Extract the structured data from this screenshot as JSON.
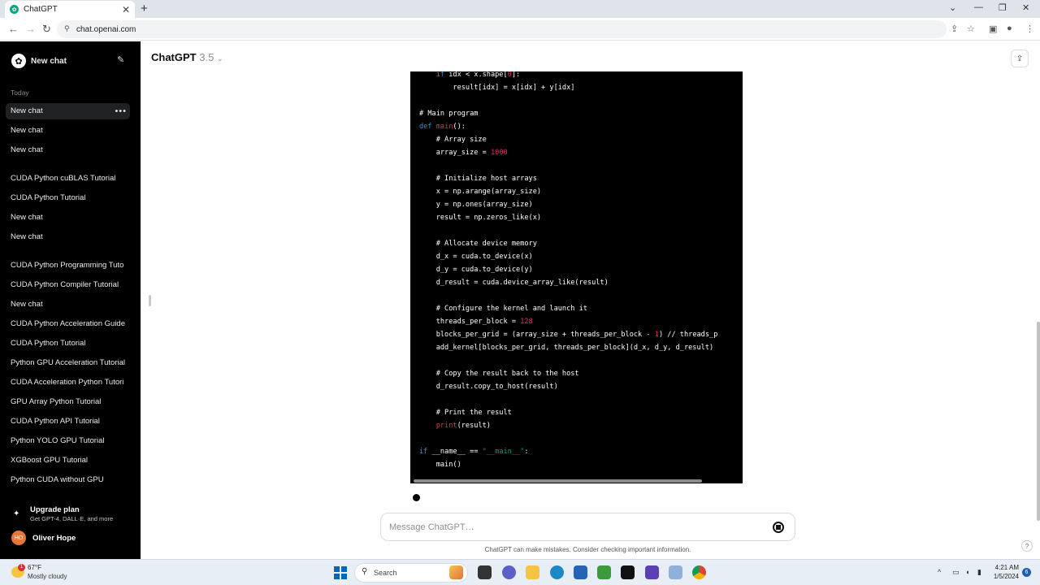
{
  "browser": {
    "tab_title": "ChatGPT",
    "url": "chat.openai.com"
  },
  "sidebar": {
    "new_chat_label": "New chat",
    "section_today": "Today",
    "items": [
      {
        "label": "New chat"
      },
      {
        "label": "New chat"
      },
      {
        "label": "New chat"
      },
      {
        "label": "CUDA Python cuBLAS Tutorial"
      },
      {
        "label": "CUDA Python Tutorial"
      },
      {
        "label": "New chat"
      },
      {
        "label": "New chat"
      },
      {
        "label": "CUDA Python Programming Tuto"
      },
      {
        "label": "CUDA Python Compiler Tutorial"
      },
      {
        "label": "New chat"
      },
      {
        "label": "CUDA Python Acceleration Guide"
      },
      {
        "label": "CUDA Python Tutorial"
      },
      {
        "label": "Python GPU Acceleration Tutorial"
      },
      {
        "label": "CUDA Acceleration Python Tutori"
      },
      {
        "label": "GPU Array Python Tutorial"
      },
      {
        "label": "CUDA Python API Tutorial"
      },
      {
        "label": "Python YOLO GPU Tutorial"
      },
      {
        "label": "XGBoost GPU Tutorial"
      },
      {
        "label": "Python CUDA without GPU"
      }
    ],
    "upgrade_title": "Upgrade plan",
    "upgrade_sub": "Get GPT-4, DALL·E, and more",
    "user_initials": "HO",
    "user_name": "Oliver Hope"
  },
  "main": {
    "model_name": "ChatGPT",
    "model_version": "3.5",
    "code_lines": [
      "    if idx < x.shape[0]:",
      "        result[idx] = x[idx] + y[idx]",
      "",
      "# Main program",
      "def main():",
      "    # Array size",
      "    array_size = 1000",
      "",
      "    # Initialize host arrays",
      "    x = np.arange(array_size)",
      "    y = np.ones(array_size)",
      "    result = np.zeros_like(x)",
      "",
      "    # Allocate device memory",
      "    d_x = cuda.to_device(x)",
      "    d_y = cuda.to_device(y)",
      "    d_result = cuda.device_array_like(result)",
      "",
      "    # Configure the kernel and launch it",
      "    threads_per_block = 128",
      "    blocks_per_grid = (array_size + threads_per_block - 1) // threads_p",
      "    add_kernel[blocks_per_grid, threads_per_block](d_x, d_y, d_result)",
      "",
      "    # Copy the result back to the host",
      "    d_result.copy_to_host(result)",
      "",
      "    # Print the result",
      "    print(result)",
      "",
      "if __name__ == \"__main__\":",
      "    main()"
    ],
    "composer_placeholder": "Message ChatGPT…",
    "disclaimer": "ChatGPT can make mistakes. Consider checking important information.",
    "help_label": "?"
  },
  "taskbar": {
    "weather_temp": "67°F",
    "weather_cond": "Mostly cloudy",
    "weather_badge": "1",
    "search_label": "Search",
    "time": "4:21 AM",
    "date": "1/5/2024",
    "notif_count": "6"
  },
  "colors": {
    "sidebar_bg": "#000000",
    "accent": "#10a37f",
    "code_bg": "#000000"
  }
}
